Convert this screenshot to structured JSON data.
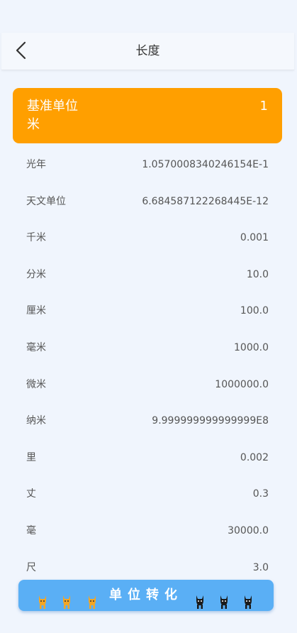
{
  "header": {
    "title": "长度"
  },
  "base": {
    "label": "基准单位",
    "unit": "米",
    "value": "1"
  },
  "units": [
    {
      "name": "光年",
      "value": "1.0570008340246154E-1"
    },
    {
      "name": "天文单位",
      "value": "6.684587122268445E-12"
    },
    {
      "name": "千米",
      "value": "0.001"
    },
    {
      "name": "分米",
      "value": "10.0"
    },
    {
      "name": "厘米",
      "value": "100.0"
    },
    {
      "name": "毫米",
      "value": "1000.0"
    },
    {
      "name": "微米",
      "value": "1000000.0"
    },
    {
      "name": "纳米",
      "value": "9.999999999999999E8"
    },
    {
      "name": "里",
      "value": "0.002"
    },
    {
      "name": "丈",
      "value": "0.3"
    },
    {
      "name": "毫",
      "value": "30000.0"
    },
    {
      "name": "尺",
      "value": "3.0"
    }
  ],
  "convert_button": {
    "label": "单位转化"
  },
  "colors": {
    "accent": "#ff9f00",
    "button": "#5aaff5",
    "background": "#f0f5fd"
  },
  "icons": {
    "back": "chevron-left-icon",
    "mascot_left": "orange-cat-icon",
    "mascot_right": "black-cat-icon"
  }
}
